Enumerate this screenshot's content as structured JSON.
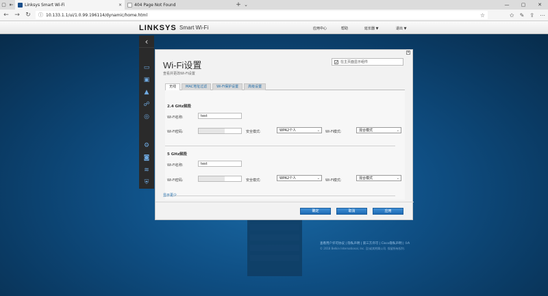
{
  "browser": {
    "tabs": [
      {
        "title": "Linksys Smart Wi-Fi",
        "active": true
      },
      {
        "title": "404 Page Not Found",
        "active": false
      }
    ],
    "url": "10.133.1.1/ui/1.0.99.196114/dynamic/home.html"
  },
  "header": {
    "logo": "LINKSYS",
    "product": "Smart Wi-Fi",
    "nav": [
      "应用中心",
      "帮助",
      "延长器 ▼",
      "退出 ▼"
    ]
  },
  "sidebar_icons": [
    "device-icon",
    "router-icon",
    "alert-icon",
    "parental-icon",
    "speed-icon",
    "settings-icon",
    "camera-icon",
    "wifi-icon",
    "security-icon"
  ],
  "dialog": {
    "title": "Wi-Fi设置",
    "subtitle": "查看并更改Wi-Fi设置",
    "show_on_home": "在主页面显示组件",
    "tabs": [
      "无线",
      "MAC地址过滤",
      "Wi-Fi保护设置",
      "高级设置"
    ],
    "band24": {
      "title": "2.4 GHz频段",
      "name_label": "Wi-Fi名称:",
      "name_value": "test",
      "pass_label": "Wi-Fi密码:",
      "security_label": "安全模式:",
      "security_value": "WPA2个人",
      "mode_label": "Wi-Fi模式:",
      "mode_value": "混合模式"
    },
    "band5": {
      "title": "5 GHz频段",
      "name_label": "Wi-Fi名称:",
      "name_value": "test",
      "pass_label": "Wi-Fi密码:",
      "security_label": "安全模式:",
      "security_value": "WPA2个人",
      "mode_label": "Wi-Fi模式:",
      "mode_value": "混合模式"
    },
    "show_less": "显示更少",
    "buttons": {
      "ok": "确定",
      "cancel": "取消",
      "apply": "应用"
    }
  },
  "footer": {
    "links": "查看用户许可协议 | 隐私声明 | 第三方许可 | Cisco隐私声明 | ①A",
    "copyright": "© 2018 Belkin International, Inc. 及/或其附属公司. 保留所有权利."
  },
  "colors": {
    "accent": "#1e6bb4",
    "sidebar": "#2a2a2a",
    "background": "#0f4f84"
  }
}
